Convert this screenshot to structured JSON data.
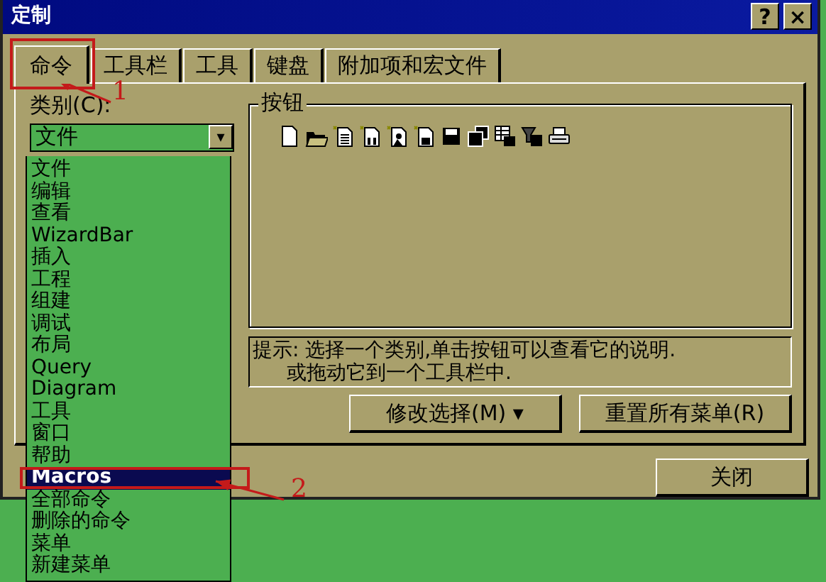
{
  "window": {
    "title": "定制",
    "help_button": "?",
    "close_button": "×"
  },
  "tabs": [
    {
      "label": "命令",
      "selected": true
    },
    {
      "label": "工具栏",
      "selected": false
    },
    {
      "label": "工具",
      "selected": false
    },
    {
      "label": "键盘",
      "selected": false
    },
    {
      "label": "附加项和宏文件",
      "selected": false
    }
  ],
  "category": {
    "label": "类别(C):",
    "value": "文件",
    "caret": "▾"
  },
  "category_list": [
    {
      "label": "文件",
      "selected": false
    },
    {
      "label": "编辑",
      "selected": false
    },
    {
      "label": "查看",
      "selected": false
    },
    {
      "label": "WizardBar",
      "selected": false
    },
    {
      "label": "插入",
      "selected": false
    },
    {
      "label": "工程",
      "selected": false
    },
    {
      "label": "组建",
      "selected": false
    },
    {
      "label": "调试",
      "selected": false
    },
    {
      "label": "布局",
      "selected": false
    },
    {
      "label": "Query",
      "selected": false
    },
    {
      "label": "Diagram",
      "selected": false
    },
    {
      "label": "工具",
      "selected": false
    },
    {
      "label": "窗口",
      "selected": false
    },
    {
      "label": "帮助",
      "selected": false
    },
    {
      "label": "Macros",
      "selected": true
    },
    {
      "label": "全部命令",
      "selected": false
    },
    {
      "label": "删除的命令",
      "selected": false
    },
    {
      "label": "菜单",
      "selected": false
    },
    {
      "label": "新建菜单",
      "selected": false
    }
  ],
  "buttons_group": {
    "title": "按钮"
  },
  "hint": {
    "lines": [
      "提示: 选择一个类别,单击按钮可以查看它的说明.",
      "或拖动它到一个工具栏中."
    ]
  },
  "actions": [
    {
      "label": "修改选择(M)",
      "caret": "▾"
    },
    {
      "label": "重置所有菜单(R)"
    }
  ],
  "close": {
    "label": "关闭"
  },
  "annotations": [
    {
      "label": "1"
    },
    {
      "label": "2"
    }
  ]
}
